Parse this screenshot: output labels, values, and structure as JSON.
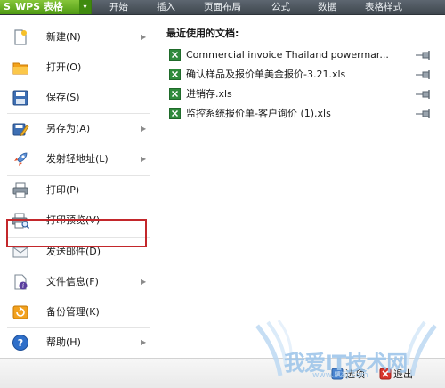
{
  "app": {
    "name": "WPS 表格",
    "logo_glyph": "S",
    "dropdown_glyph": "▾"
  },
  "ribbon": {
    "tabs": [
      {
        "label": "开始"
      },
      {
        "label": "插入"
      },
      {
        "label": "页面布局"
      },
      {
        "label": "公式"
      },
      {
        "label": "数据"
      },
      {
        "label": "表格样式"
      }
    ]
  },
  "menu": {
    "items": [
      {
        "label": "新建(N)",
        "icon": "new-document-icon",
        "submenu": true
      },
      {
        "label": "打开(O)",
        "icon": "open-folder-icon",
        "submenu": false
      },
      {
        "label": "保存(S)",
        "icon": "save-disk-icon",
        "submenu": false
      },
      {
        "label": "另存为(A)",
        "icon": "save-as-icon",
        "submenu": true
      },
      {
        "label": "发射轻地址(L)",
        "icon": "rocket-icon",
        "submenu": true
      },
      {
        "label": "打印(P)",
        "icon": "printer-icon",
        "submenu": false
      },
      {
        "label": "打印预览(V)",
        "icon": "print-preview-icon",
        "submenu": false,
        "highlighted": true
      },
      {
        "label": "发送邮件(D)",
        "icon": "mail-envelope-icon",
        "submenu": false
      },
      {
        "label": "文件信息(F)",
        "icon": "file-info-icon",
        "submenu": true
      },
      {
        "label": "备份管理(K)",
        "icon": "backup-icon",
        "submenu": false
      },
      {
        "label": "帮助(H)",
        "icon": "help-icon",
        "submenu": true
      }
    ],
    "submenu_glyph": "▶",
    "highlight_color": "#c3272b"
  },
  "recent": {
    "title": "最近使用的文档:",
    "docs": [
      {
        "name": "Commercial invoice Thailand powermar..."
      },
      {
        "name": "确认样品及报价单美金报价-3.21.xls"
      },
      {
        "name": "进销存.xls"
      },
      {
        "name": "监控系统报价单-客户询价 (1).xls"
      }
    ]
  },
  "footer": {
    "options_label": "选项",
    "exit_label": "退出"
  },
  "watermark": {
    "text": "我爱IT技术网",
    "subtext": "www.52ij.com"
  },
  "colors": {
    "app_green": "#5fa61c",
    "topbar": "#4a535b",
    "xls_green": "#2f8a3c"
  }
}
